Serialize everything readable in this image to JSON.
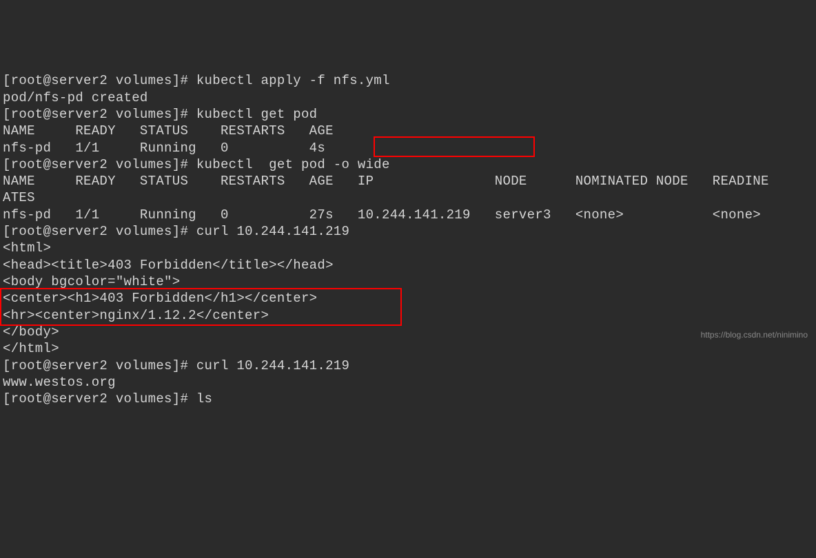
{
  "lines": {
    "l1_prompt": "[root@server2 volumes]# ",
    "l1_cmd": "kubectl apply -f nfs.yml",
    "l2": "pod/nfs-pd created",
    "l3_prompt": "[root@server2 volumes]# ",
    "l3_cmd": "kubectl get pod",
    "l4": "NAME     READY   STATUS    RESTARTS   AGE",
    "l5": "nfs-pd   1/1     Running   0          4s",
    "l6_prompt": "[root@server2 volumes]# ",
    "l6_cmd": "kubectl  get pod -o wide",
    "l7": "NAME     READY   STATUS    RESTARTS   AGE   IP               NODE      NOMINATED NODE   READINE",
    "l8": "ATES",
    "l9": "nfs-pd   1/1     Running   0          27s   10.244.141.219   server3   <none>           <none>",
    "l10_prompt": "[root@server2 volumes]# ",
    "l10_cmd": "curl 10.244.141.219",
    "l11": "<html>",
    "l12": "<head><title>403 Forbidden</title></head>",
    "l13": "<body bgcolor=\"white\">",
    "l14": "<center><h1>403 Forbidden</h1></center>",
    "l15": "<hr><center>nginx/1.12.2</center>",
    "l16": "</body>",
    "l17": "</html>",
    "l18_prompt": "[root@server2 volumes]# ",
    "l18_cmd": "curl 10.244.141.219",
    "l19": "www.westos.org",
    "l20_prompt": "[root@server2 volumes]# ",
    "l20_cmd": "ls"
  },
  "watermark": "https://blog.csdn.net/ninimino"
}
